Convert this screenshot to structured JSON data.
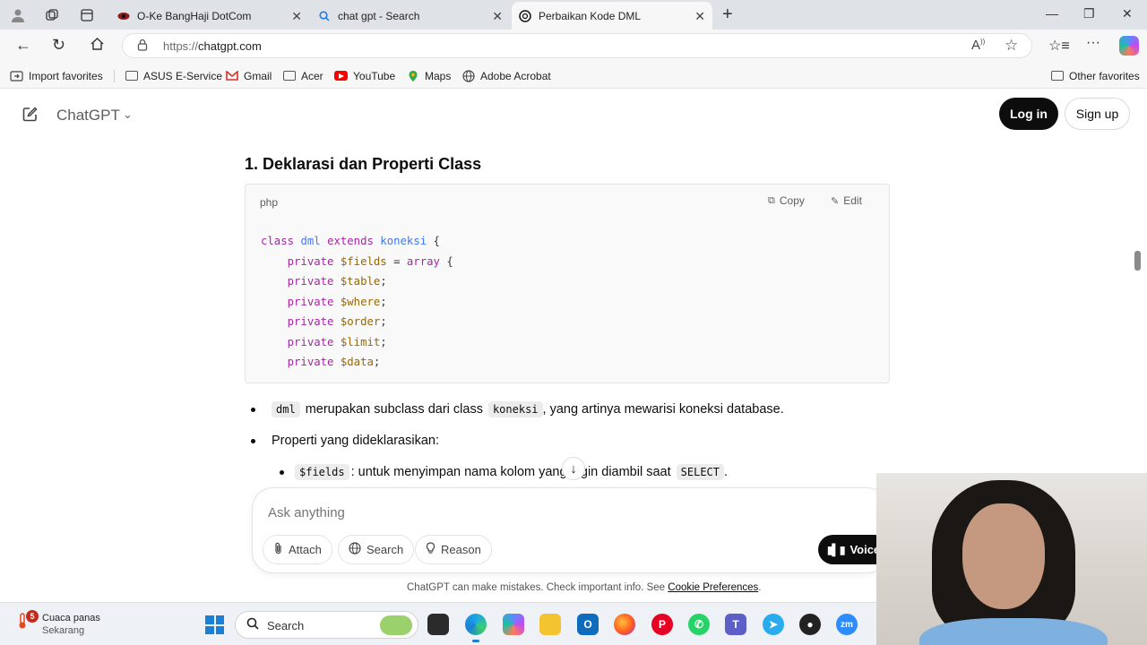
{
  "browser": {
    "tabs": [
      {
        "title": "O-Ke BangHaji DotCom",
        "favicon": "site-icon"
      },
      {
        "title": "chat gpt - Search",
        "favicon": "search-icon"
      },
      {
        "title": "Perbaikan Kode DML",
        "favicon": "chatgpt-icon",
        "active": true
      }
    ],
    "url_prefix": "https://",
    "url_host": "chatgpt.com",
    "favorites": [
      {
        "label": "Import favorites",
        "icon": "import-icon"
      },
      {
        "label": "ASUS E-Service",
        "icon": "folder-icon"
      },
      {
        "label": "Gmail",
        "icon": "gmail-icon"
      },
      {
        "label": "Acer",
        "icon": "folder-icon"
      },
      {
        "label": "YouTube",
        "icon": "youtube-icon"
      },
      {
        "label": "Maps",
        "icon": "maps-icon"
      },
      {
        "label": "Adobe Acrobat",
        "icon": "globe-icon"
      }
    ],
    "other_favorites": "Other favorites"
  },
  "chatgpt": {
    "title": "ChatGPT",
    "login_label": "Log in",
    "signup_label": "Sign up",
    "heading": "1. Deklarasi dan Properti Class",
    "code": {
      "lang": "php",
      "copy_label": "Copy",
      "edit_label": "Edit",
      "lines": [
        {
          "kw": "class",
          "cls": "dml",
          "kw2": "extends",
          "cls2": "koneksi",
          "tail": " {"
        },
        {
          "kw": "private",
          "var": "$fields",
          "rest": " = ",
          "kw2": "array",
          "tail": " {"
        },
        {
          "kw": "private",
          "var": "$table",
          "tail": ";"
        },
        {
          "kw": "private",
          "var": "$where",
          "tail": ";"
        },
        {
          "kw": "private",
          "var": "$order",
          "tail": ";"
        },
        {
          "kw": "private",
          "var": "$limit",
          "tail": ";"
        },
        {
          "kw": "private",
          "var": "$data",
          "tail": ";"
        }
      ]
    },
    "bullets": [
      {
        "code": "dml",
        "text": "merupakan subclass dari class",
        "code2": "koneksi",
        "text2": ", yang artinya mewarisi koneksi database."
      },
      {
        "text": "Properti yang dideklarasikan:"
      },
      {
        "code": "$fields",
        "text": ": untuk menyimpan nama kolom yang ingin diambil saat",
        "code2": "SELECT",
        "text2": "."
      }
    ],
    "composer": {
      "placeholder": "Ask anything",
      "attach_label": "Attach",
      "search_label": "Search",
      "reason_label": "Reason",
      "voice_label": "Voice"
    },
    "disclaimer": "ChatGPT can make mistakes. Check important info. See",
    "disclaimer_link": "Cookie Preferences",
    "disclaimer_end": "."
  },
  "taskbar": {
    "weather_title": "Cuaca panas",
    "weather_sub": "Sekarang",
    "weather_badge": "5",
    "search_label": "Search"
  }
}
